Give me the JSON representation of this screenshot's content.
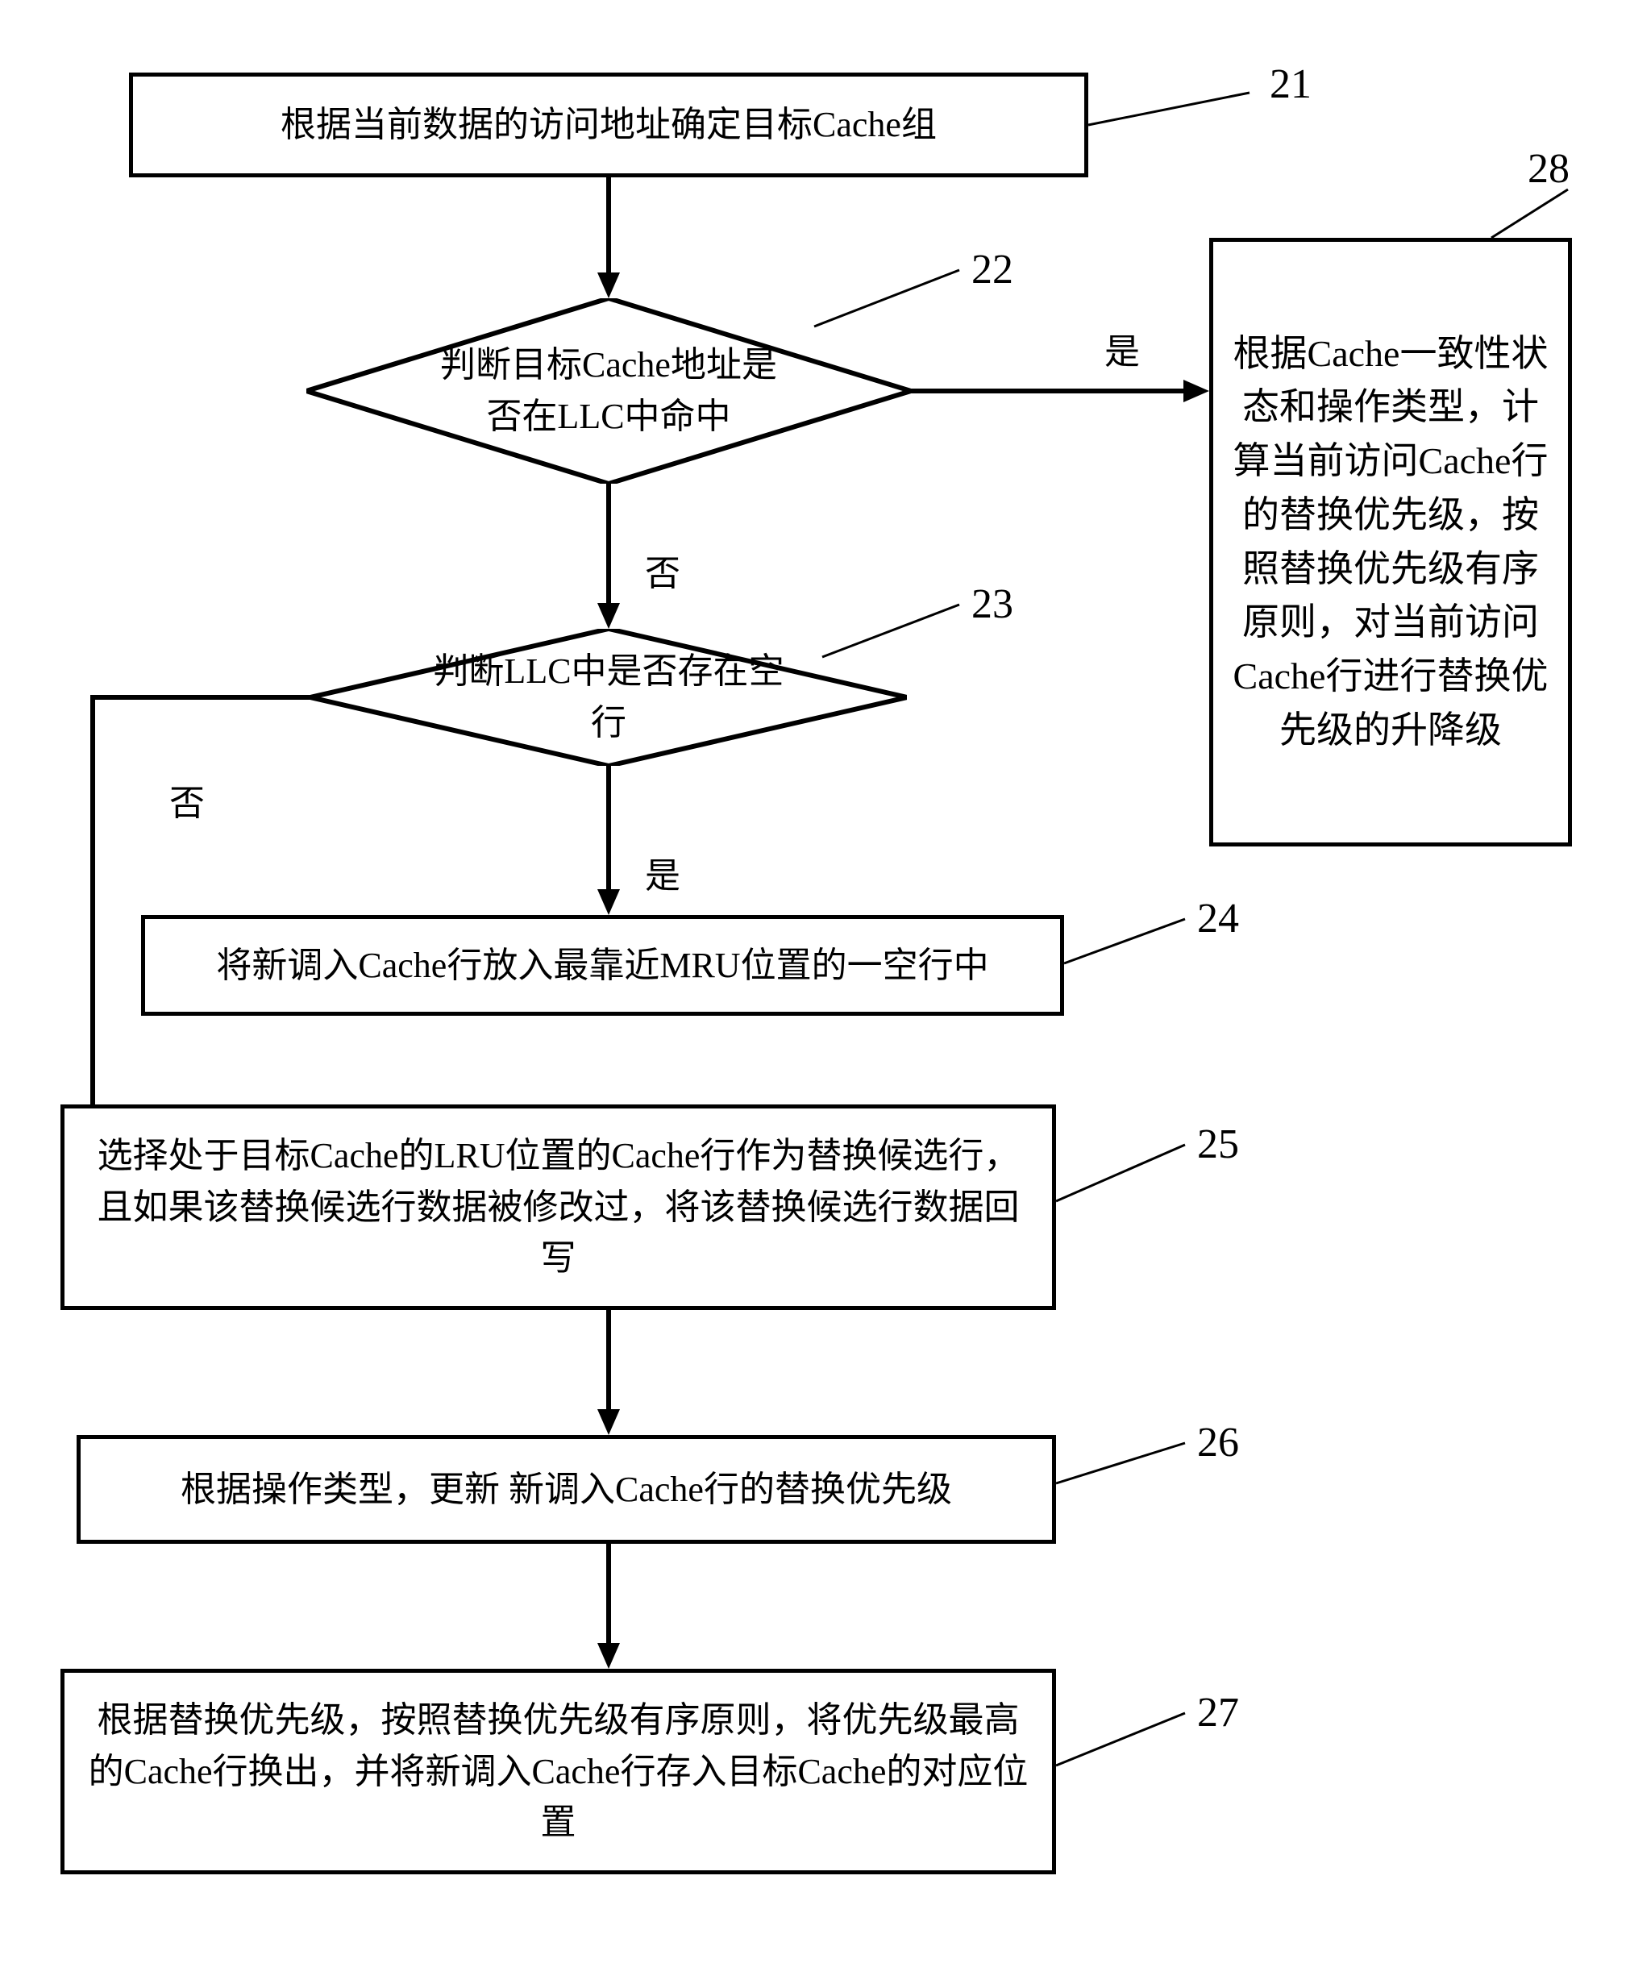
{
  "nodes": {
    "n21": "根据当前数据的访问地址确定目标Cache组",
    "n22": "判断目标Cache地址是否在LLC中命中",
    "n23": "判断LLC中是否存在空行",
    "n24": "将新调入Cache行放入最靠近MRU位置的一空行中",
    "n25": "选择处于目标Cache的LRU位置的Cache行作为替换候选行，且如果该替换候选行数据被修改过，将该替换候选行数据回写",
    "n26": "根据操作类型，更新 新调入Cache行的替换优先级",
    "n27": "根据替换优先级，按照替换优先级有序原则，将优先级最高的Cache行换出，并将新调入Cache行存入目标Cache的对应位置",
    "n28": "根据Cache一致性状态和操作类型，计算当前访问Cache行的替换优先级，按照替换优先级有序原则，对当前访问Cache行进行替换优先级的升降级"
  },
  "labels": {
    "l21": "21",
    "l22": "22",
    "l23": "23",
    "l24": "24",
    "l25": "25",
    "l26": "26",
    "l27": "27",
    "l28": "28"
  },
  "edges": {
    "yes22": "是",
    "no22": "否",
    "yes23": "是",
    "no23": "否"
  }
}
